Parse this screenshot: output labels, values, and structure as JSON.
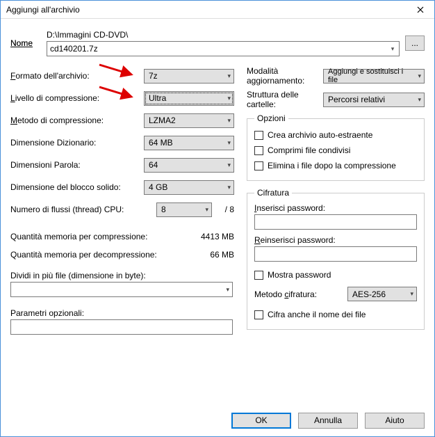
{
  "window": {
    "title": "Aggiungi all'archivio"
  },
  "name": {
    "label": "Nome",
    "path": "D:\\Immagini CD-DVD\\",
    "file": "cd140201.7z",
    "browse": "..."
  },
  "left": {
    "format_label": "Formato dell'archivio:",
    "format_value": "7z",
    "level_label": "Livello di compressione:",
    "level_value": "Ultra",
    "method_label": "Metodo di compressione:",
    "method_value": "LZMA2",
    "dict_label": "Dimensione Dizionario:",
    "dict_value": "64 MB",
    "word_label": "Dimensioni Parola:",
    "word_value": "64",
    "solid_label": "Dimensione del blocco solido:",
    "solid_value": "4 GB",
    "threads_label": "Numero di flussi (thread) CPU:",
    "threads_value": "8",
    "threads_suffix": "/ 8",
    "mem_comp_label": "Quantità memoria per compressione:",
    "mem_comp_value": "4413 MB",
    "mem_decomp_label": "Quantità memoria per decompressione:",
    "mem_decomp_value": "66 MB",
    "split_label": "Dividi in più file (dimensione in byte):",
    "params_label": "Parametri opzionali:"
  },
  "right": {
    "update_label": "Modalità aggiornamento:",
    "update_value": "Aggiungi e sostituisci i file",
    "paths_label": "Struttura delle cartelle:",
    "paths_value": "Percorsi relativi",
    "options_legend": "Opzioni",
    "opt_sfx": "Crea archivio auto-estraente",
    "opt_shared": "Comprimi file condivisi",
    "opt_delete": "Elimina i file dopo la compressione",
    "enc_legend": "Cifratura",
    "pw1_label": "Inserisci password:",
    "pw2_label": "Reinserisci password:",
    "show_pw": "Mostra password",
    "enc_method_label": "Metodo cifratura:",
    "enc_method_value": "AES-256",
    "enc_names": "Cifra anche il nome dei file"
  },
  "footer": {
    "ok": "OK",
    "cancel": "Annulla",
    "help": "Aiuto"
  }
}
